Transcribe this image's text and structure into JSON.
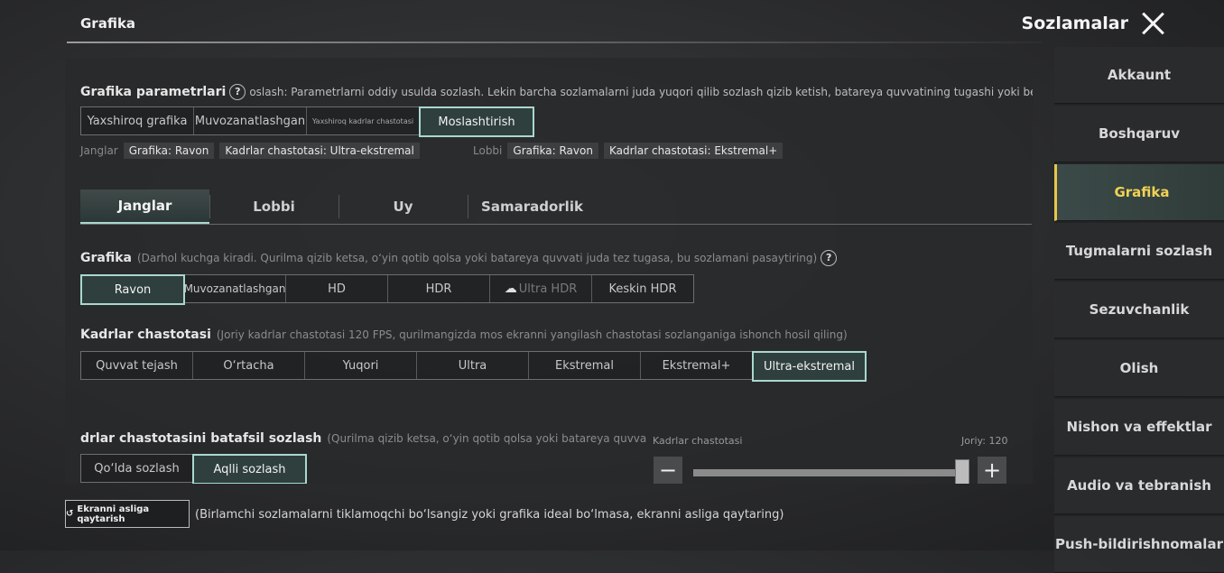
{
  "header": {
    "section": "Grafika",
    "title": "Sozlamalar",
    "close_icon": "close-icon"
  },
  "params": {
    "title": "Grafika parametrlari",
    "help": "?",
    "desc": "oslash: Parametrlarni oddiy usulda sozlash. Lekin barcha sozlamalarni juda yuqori qilib sozlash qizib ketish, batareya quvvatining tugashi yoki beqaror ge",
    "options": [
      "Yaxshiroq grafika",
      "Muvozanatlashgan",
      "Yaxshiroq kadrlar chastotasi",
      "Moslashtirish"
    ],
    "selected": "Moslashtirish",
    "battles_label": "Janglar",
    "battles_graphics": "Grafika: Ravon",
    "battles_fps": "Kadrlar chastotasi: Ultra-ekstremal",
    "lobby_label": "Lobbi",
    "lobby_graphics": "Grafika: Ravon",
    "lobby_fps": "Kadrlar chastotasi: Ekstremal+"
  },
  "tabs": [
    "Janglar",
    "Lobbi",
    "Uy",
    "Samaradorlik"
  ],
  "active_tab": "Janglar",
  "graphics": {
    "title": "Grafika",
    "desc": "(Darhol kuchga kiradi. Qurilma qizib ketsa, o‘yin qotib qolsa yoki batareya quvvati juda tez tugasa, bu sozlamani pasaytiring)",
    "help": "?",
    "options": [
      "Ravon",
      "Muvozanatlashgan",
      "HD",
      "HDR",
      "Ultra HDR",
      "Keskin HDR"
    ],
    "selected": "Ravon",
    "cloud_icon": "☁"
  },
  "framerate": {
    "title": "Kadrlar chastotasi",
    "desc": "(Joriy kadrlar chastotasi 120 FPS, qurilmangizda mos ekranni yangilash chastotasi sozlanganiga ishonch hosil qiling)",
    "options": [
      "Quvvat tejash",
      "O‘rtacha",
      "Yuqori",
      "Ultra",
      "Ekstremal",
      "Ekstremal+",
      "Ultra-ekstremal"
    ],
    "selected": "Ultra-ekstremal"
  },
  "detailed": {
    "title": "drlar chastotasini batafsil sozlash",
    "desc": "(Qurilma qizib ketsa, o‘yin qotib qolsa yoki batareya quvvati juda tez tug",
    "options": [
      "Qo‘lda sozlash",
      "Aqlli sozlash"
    ],
    "selected": "Aqlli sozlash",
    "slider_label": "Kadrlar chastotasi",
    "current": "Joriy: 120",
    "minus": "−",
    "plus": "+",
    "value_fraction": 1.0
  },
  "reset": {
    "button": "Ekranni asliga qaytarish",
    "icon": "↺",
    "desc": "(Birlamchi sozlamalarni tiklamoqchi bo‘lsangiz yoki grafika ideal bo‘lmasa, ekranni asliga qaytaring)"
  },
  "sidebar": [
    "Akkaunt",
    "Boshqaruv",
    "Grafika",
    "Tugmalarni sozlash",
    "Sezuvchanlik",
    "Olish",
    "Nishon va effektlar",
    "Audio va tebranish",
    "Push-bildirishnomalar"
  ],
  "sidebar_active": "Grafika",
  "colors": {
    "accent": "#a9d8cf",
    "active_tab_text": "#f1d256"
  }
}
